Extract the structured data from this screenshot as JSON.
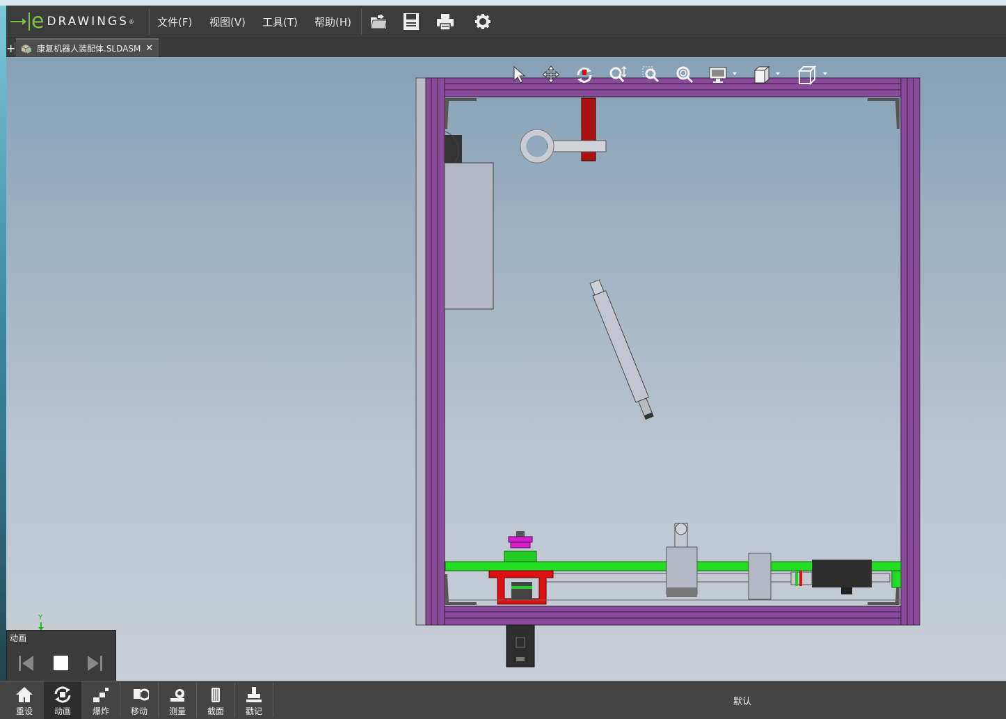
{
  "app": {
    "logo_text": "DRAWINGS",
    "logo_mark": "e",
    "brand_color": "#7cc242"
  },
  "menu": {
    "items": [
      "文件(F)",
      "视图(V)",
      "工具(T)",
      "帮助(H)"
    ]
  },
  "toolbar": {
    "icons": [
      "open-folder-icon",
      "save-icon",
      "print-icon",
      "settings-gear-icon"
    ]
  },
  "tabs": {
    "add_label": "+",
    "active": {
      "label": "康复机器人装配体.SLDASM",
      "close": "✕"
    }
  },
  "view_toolbar": {
    "icons": [
      "select-arrow-icon",
      "pan-icon",
      "rotate-icon",
      "zoom-to-fit-icon",
      "zoom-to-area-icon",
      "zoom-icon",
      "display-style-icon",
      "view-orientation-icon",
      "standard-views-icon"
    ]
  },
  "model": {
    "colors": {
      "frame": "#8a4a9a",
      "base_rail": "#22dd22",
      "bracket": "#cc1111",
      "part_gray": "#b5b9c6",
      "magenta_part": "#d21fc9"
    }
  },
  "triad": {
    "axis_label": "Y"
  },
  "animation": {
    "title": "动画",
    "controls": [
      "skip-back-icon",
      "stop-icon",
      "skip-forward-icon"
    ]
  },
  "bottom_toolbar": {
    "items": [
      {
        "label": "重设",
        "icon": "home-icon"
      },
      {
        "label": "动画",
        "icon": "animate-icon"
      },
      {
        "label": "爆炸",
        "icon": "explode-icon"
      },
      {
        "label": "移动",
        "icon": "move-icon"
      },
      {
        "label": "测量",
        "icon": "measure-icon"
      },
      {
        "label": "截面",
        "icon": "section-icon"
      },
      {
        "label": "戳记",
        "icon": "stamp-icon"
      }
    ],
    "configuration": "默认"
  }
}
